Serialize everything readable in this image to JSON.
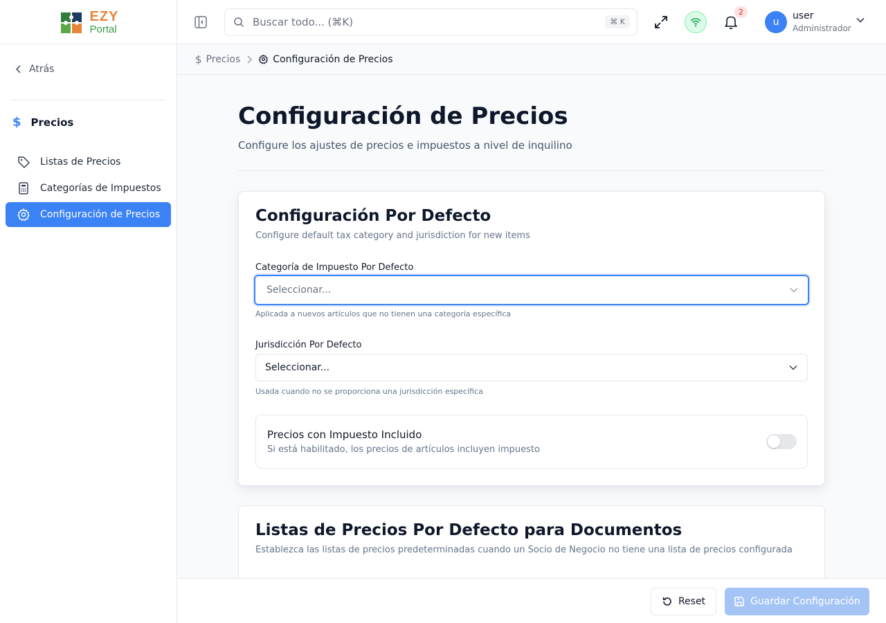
{
  "brand": {
    "logo_top": "EZY",
    "logo_bottom": "Portal"
  },
  "sidebar": {
    "back_label": "Atrás",
    "section_title": "Precios",
    "items": [
      {
        "label": "Listas de Precios",
        "icon": "tag-icon"
      },
      {
        "label": "Categorías de Impuestos",
        "icon": "calculator-icon"
      },
      {
        "label": "Configuración de Precios",
        "icon": "gear-icon",
        "active": true
      }
    ]
  },
  "header": {
    "search_placeholder": "Buscar todo... (⌘K)",
    "shortcut": "⌘ K",
    "notifications_count": "2",
    "user": {
      "initial": "u",
      "name": "user",
      "role": "Administrador"
    }
  },
  "breadcrumb": {
    "parent": "Precios",
    "current": "Configuración de Precios"
  },
  "page": {
    "title": "Configuración de Precios",
    "subtitle": "Configure los ajustes de precios e impuestos a nivel de inquilino"
  },
  "defaults_card": {
    "title": "Configuración Por Defecto",
    "subtitle": "Configure default tax category and jurisdiction for new items",
    "tax_category": {
      "label": "Categoría de Impuesto Por Defecto",
      "value": "Seleccionar...",
      "help": "Aplicada a nuevos artículos que no tienen una categoría específica"
    },
    "jurisdiction": {
      "label": "Jurisdicción Por Defecto",
      "value": "Seleccionar...",
      "help": "Usada cuando no se proporciona una jurisdicción específica"
    },
    "tax_included": {
      "title": "Precios con Impuesto Incluido",
      "description": "Si está habilitado, los precios de artículos incluyen impuesto",
      "enabled": false
    }
  },
  "pricelists_card": {
    "title": "Listas de Precios Por Defecto para Documentos",
    "subtitle": "Establezca las listas de precios predeterminadas cuando un Socio de Negocio no tiene una lista de precios configurada"
  },
  "footer": {
    "reset_label": "Reset",
    "save_label": "Guardar Configuración"
  },
  "colors": {
    "accent": "#3b82f6",
    "save_disabled": "#a5c4f6",
    "logo_orange": "#e8833a",
    "logo_green": "#3a9a4a"
  }
}
